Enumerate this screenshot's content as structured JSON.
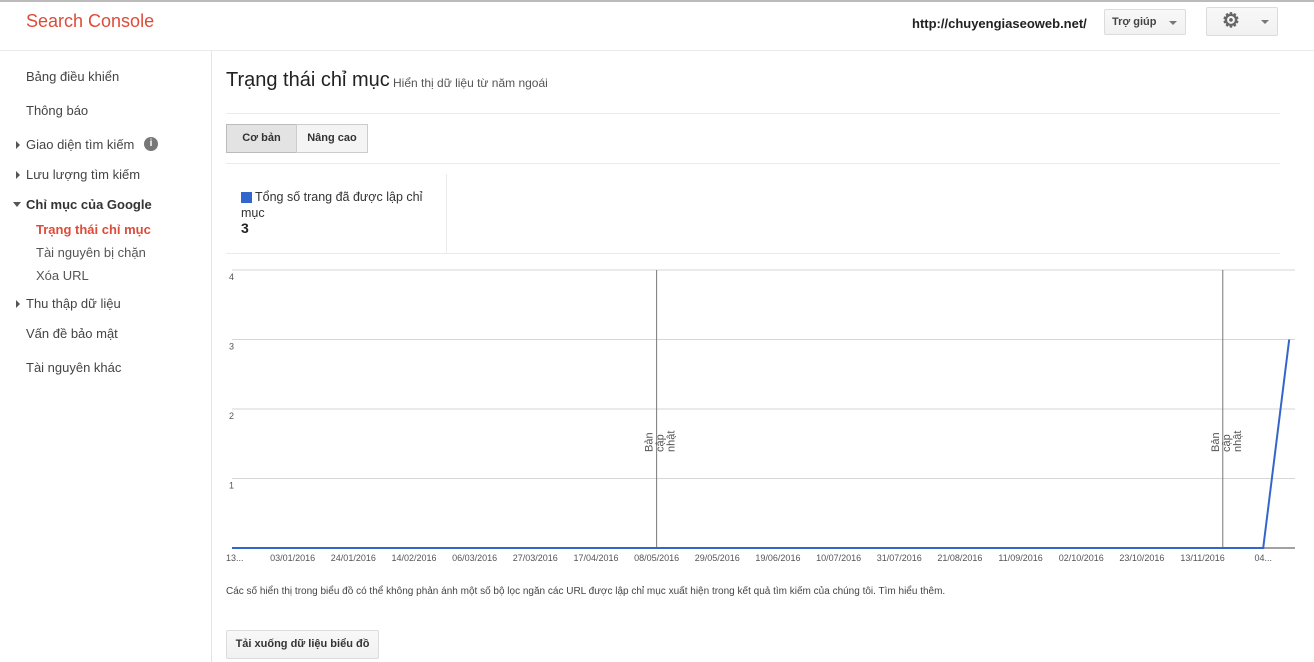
{
  "header": {
    "app_title": "Search Console",
    "site_url": "http://chuyengiaseoweb.net/",
    "help_label": "Trợ giúp",
    "settings_icon": "gear-icon"
  },
  "sidebar": {
    "items": [
      {
        "label": "Bảng điều khiển"
      },
      {
        "label": "Thông báo"
      },
      {
        "label": "Giao diện tìm kiếm"
      },
      {
        "label": "Lưu lượng tìm kiếm"
      },
      {
        "label": "Chỉ mục của Google"
      },
      {
        "label": "Trạng thái chỉ mục"
      },
      {
        "label": "Tài nguyên bị chặn"
      },
      {
        "label": "Xóa URL"
      },
      {
        "label": "Thu thập dữ liệu"
      },
      {
        "label": "Vấn đề bảo mật"
      },
      {
        "label": "Tài nguyên khác"
      }
    ],
    "info_icon_text": "i"
  },
  "main": {
    "title": "Trạng thái chỉ mục",
    "subtitle": "Hiển thị dữ liệu từ năm ngoái",
    "tabs": [
      {
        "label": "Cơ bản",
        "selected": true
      },
      {
        "label": "Nâng cao",
        "selected": false
      }
    ],
    "stat": {
      "label": "Tổng số trang đã được lập chỉ mục",
      "value": "3",
      "color": "#3366cc"
    },
    "footnote": "Các số hiển thị trong biểu đồ có thể không phản ánh một số bộ lọc ngăn các URL được lập chỉ mục xuất hiện trong kết quả tìm kiếm của chúng tôi. Tìm hiểu thêm.",
    "download_label": "Tải xuống dữ liệu biểu đồ"
  },
  "chart_data": {
    "type": "line",
    "series": [
      {
        "name": "Tổng số trang đã được lập chỉ mục",
        "color": "#3366cc",
        "points": [
          {
            "date": "2015-12-13",
            "value": 0
          },
          {
            "date": "2016-12-04",
            "value": 0
          },
          {
            "date": "2016-12-13",
            "value": 3
          }
        ]
      }
    ],
    "ylim": [
      0,
      4
    ],
    "yticks": [
      "1",
      "2",
      "3",
      "4"
    ],
    "xticks": [
      {
        "label": "13...",
        "date": "2015-12-13"
      },
      {
        "label": "03/01/2016",
        "date": "2016-01-03"
      },
      {
        "label": "24/01/2016",
        "date": "2016-01-24"
      },
      {
        "label": "14/02/2016",
        "date": "2016-02-14"
      },
      {
        "label": "06/03/2016",
        "date": "2016-03-06"
      },
      {
        "label": "27/03/2016",
        "date": "2016-03-27"
      },
      {
        "label": "17/04/2016",
        "date": "2016-04-17"
      },
      {
        "label": "08/05/2016",
        "date": "2016-05-08"
      },
      {
        "label": "29/05/2016",
        "date": "2016-05-29"
      },
      {
        "label": "19/06/2016",
        "date": "2016-06-19"
      },
      {
        "label": "10/07/2016",
        "date": "2016-07-10"
      },
      {
        "label": "31/07/2016",
        "date": "2016-07-31"
      },
      {
        "label": "21/08/2016",
        "date": "2016-08-21"
      },
      {
        "label": "11/09/2016",
        "date": "2016-09-11"
      },
      {
        "label": "02/10/2016",
        "date": "2016-10-02"
      },
      {
        "label": "23/10/2016",
        "date": "2016-10-23"
      },
      {
        "label": "13/11/2016",
        "date": "2016-11-13"
      },
      {
        "label": "04...",
        "date": "2016-12-04"
      }
    ],
    "x_range": [
      "2015-12-13",
      "2016-12-15"
    ],
    "annotations": [
      {
        "date": "2016-05-08",
        "lines": [
          "Bản",
          "cập",
          "nhật"
        ]
      },
      {
        "date": "2016-11-20",
        "lines": [
          "Bản",
          "cập",
          "nhật"
        ]
      }
    ],
    "grid": true
  }
}
